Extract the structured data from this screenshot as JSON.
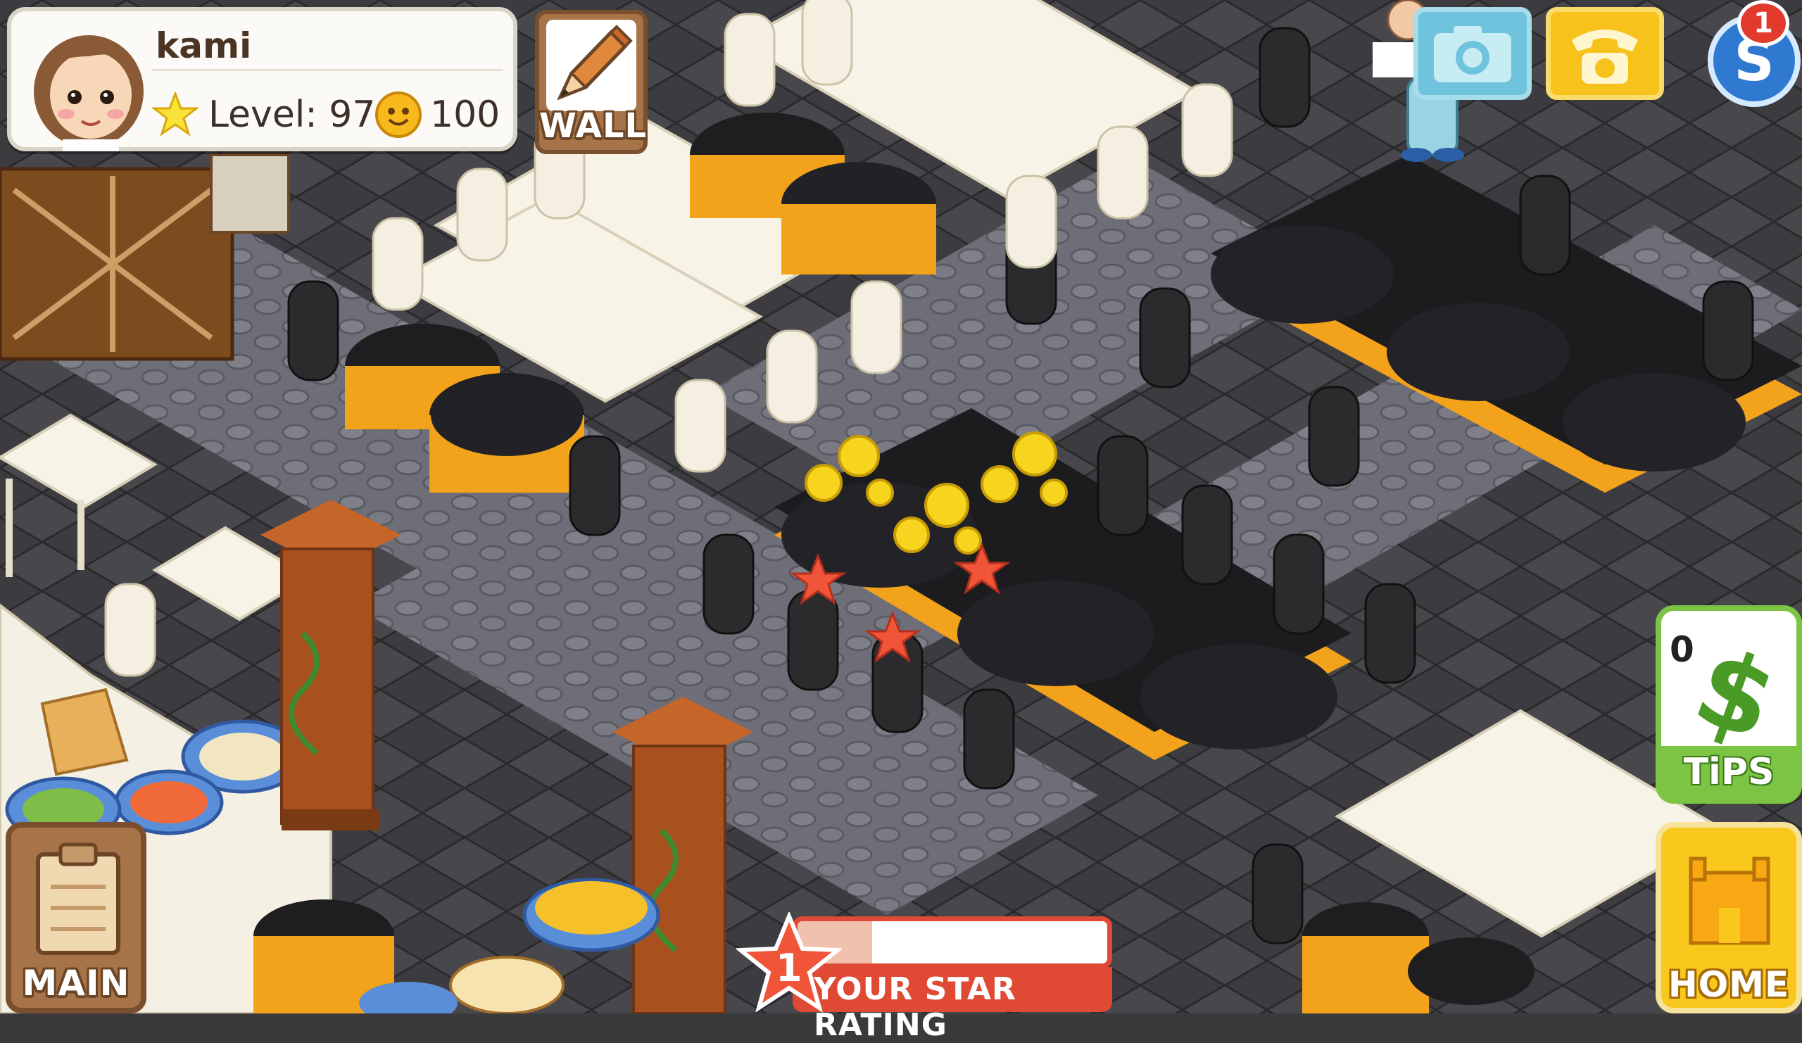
{
  "player": {
    "name": "kami",
    "level_label": "Level: 97",
    "coins": "100"
  },
  "buttons": {
    "wall_label": "WALL",
    "main_label": "MAIN",
    "home_label": "HOME",
    "tips_label": "TiPS",
    "tips_count": "0",
    "notification_count": "1"
  },
  "rating": {
    "label": "YOUR STAR RATING",
    "stars": "1",
    "progress": 0.24
  },
  "icons": {
    "camera": "camera-icon",
    "phone": "phone-icon",
    "social": "s-logo-icon",
    "level": "star-icon",
    "coin": "coin-icon"
  },
  "colors": {
    "tips_green": "#7cc443",
    "home_yellow": "#f9c81d",
    "rating_red": "#e04a34",
    "camera_blue": "#6fc3dc"
  }
}
